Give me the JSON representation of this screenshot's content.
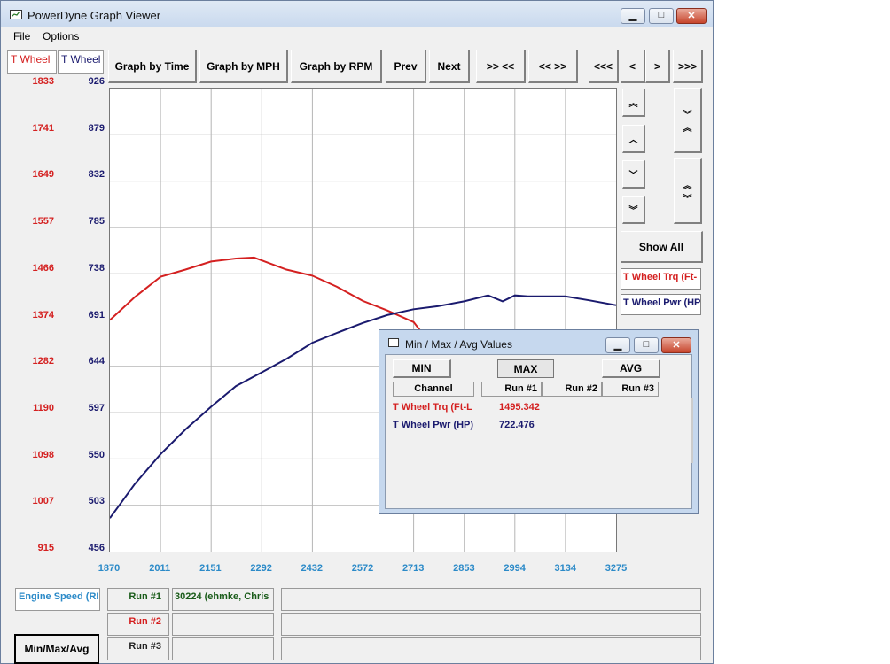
{
  "window": {
    "title": "PowerDyne Graph Viewer"
  },
  "menu": {
    "file": "File",
    "options": "Options"
  },
  "channels": {
    "left_tab": "T Wheel",
    "right_tab": "T Wheel",
    "left_color": "#d42020",
    "right_color": "#1a1a6e"
  },
  "toolbar": {
    "graph_time": "Graph by Time",
    "graph_mph": "Graph by MPH",
    "graph_rpm": "Graph by RPM",
    "prev": "Prev",
    "next": "Next",
    "zoom_in": ">> <<",
    "zoom_out": "<< >>",
    "scroll_far_left": "<<<",
    "scroll_left": "<",
    "scroll_right": ">",
    "scroll_far_right": ">>>"
  },
  "side": {
    "show_all": "Show All",
    "legend_trq": "T Wheel Trq (Ft-",
    "legend_pwr": "T Wheel Pwr (HP"
  },
  "y_left_ticks": [
    "1833",
    "1741",
    "1649",
    "1557",
    "1466",
    "1374",
    "1282",
    "1190",
    "1098",
    "1007",
    "915"
  ],
  "y_right_ticks": [
    "926",
    "879",
    "832",
    "785",
    "738",
    "691",
    "644",
    "597",
    "550",
    "503",
    "456"
  ],
  "x_ticks": [
    "1870",
    "2011",
    "2151",
    "2292",
    "2432",
    "2572",
    "2713",
    "2853",
    "2994",
    "3134",
    "3275"
  ],
  "chart_data": {
    "type": "line",
    "xlabel": "",
    "ylabel": "",
    "xlim": [
      1870,
      3275
    ],
    "y_left_lim": [
      915,
      1833
    ],
    "y_right_lim": [
      456,
      926
    ],
    "grid": true,
    "series": [
      {
        "name": "T Wheel Trq (Ft-L",
        "axis": "left",
        "color": "#d42020",
        "x": [
          1870,
          1940,
          2011,
          2080,
          2151,
          2220,
          2270,
          2300,
          2360,
          2432,
          2500,
          2572,
          2640,
          2713,
          2740
        ],
        "y": [
          1374,
          1420,
          1460,
          1474,
          1490,
          1496,
          1498,
          1490,
          1474,
          1462,
          1440,
          1412,
          1393,
          1370,
          1345
        ]
      },
      {
        "name": "T Wheel Pwr (HP)",
        "axis": "right",
        "color": "#1a1a6e",
        "x": [
          1870,
          1940,
          2011,
          2080,
          2151,
          2220,
          2292,
          2362,
          2432,
          2500,
          2572,
          2640,
          2713,
          2780,
          2853,
          2920,
          2960,
          2994,
          3030,
          3134,
          3200,
          3275
        ],
        "y": [
          490,
          525,
          555,
          580,
          603,
          624,
          638,
          652,
          668,
          678,
          688,
          696,
          702,
          705,
          710,
          716,
          710,
          716,
          715,
          715,
          711,
          706
        ]
      }
    ]
  },
  "bottom": {
    "channel_label": "Engine Speed (RI",
    "run1": "Run #1",
    "run2": "Run #2",
    "run3": "Run #3",
    "run1_value": "30224 (ehmke, Chris",
    "minmax_button": "Min/Max/Avg"
  },
  "dialog": {
    "title": "Min / Max / Avg Values",
    "min": "MIN",
    "max": "MAX",
    "avg": "AVG",
    "col_channel": "Channel",
    "col_run1": "Run #1",
    "col_run2": "Run #2",
    "col_run3": "Run #3",
    "rows": [
      {
        "channel": "T Wheel Trq (Ft-L",
        "run1": "1495.342"
      },
      {
        "channel": "T Wheel Pwr (HP)",
        "run1": "722.476"
      }
    ]
  }
}
